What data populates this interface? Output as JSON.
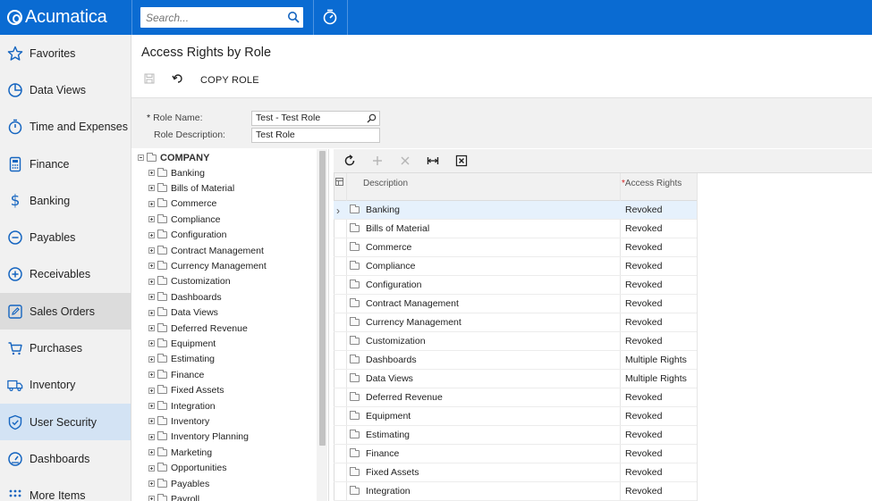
{
  "app": {
    "logo_text": "Acumatica"
  },
  "header": {
    "search_placeholder": "Search..."
  },
  "sidebar": {
    "items": [
      {
        "label": "Favorites",
        "icon": "star-icon"
      },
      {
        "label": "Data Views",
        "icon": "pie-chart-icon"
      },
      {
        "label": "Time and Expenses",
        "icon": "stopwatch-icon"
      },
      {
        "label": "Finance",
        "icon": "calculator-icon"
      },
      {
        "label": "Banking",
        "icon": "dollar-icon"
      },
      {
        "label": "Payables",
        "icon": "minus-circle-icon"
      },
      {
        "label": "Receivables",
        "icon": "plus-circle-icon"
      },
      {
        "label": "Sales Orders",
        "icon": "edit-icon"
      },
      {
        "label": "Purchases",
        "icon": "cart-icon"
      },
      {
        "label": "Inventory",
        "icon": "truck-icon"
      },
      {
        "label": "User Security",
        "icon": "shield-icon"
      },
      {
        "label": "Dashboards",
        "icon": "gauge-icon"
      },
      {
        "label": "More Items",
        "icon": "grid-dots-icon"
      }
    ]
  },
  "page": {
    "title": "Access Rights by Role",
    "toolbar": {
      "copy_role_label": "COPY ROLE"
    },
    "form": {
      "role_name_label": "Role Name:",
      "role_name_value": "Test - Test Role",
      "role_description_label": "Role Description:",
      "role_description_value": "Test Role"
    }
  },
  "tree": {
    "root": "COMPANY",
    "nodes": [
      "Banking",
      "Bills of Material",
      "Commerce",
      "Compliance",
      "Configuration",
      "Contract Management",
      "Currency Management",
      "Customization",
      "Dashboards",
      "Data Views",
      "Deferred Revenue",
      "Equipment",
      "Estimating",
      "Finance",
      "Fixed Assets",
      "Integration",
      "Inventory",
      "Inventory Planning",
      "Marketing",
      "Opportunities",
      "Payables",
      "Payroll"
    ]
  },
  "grid": {
    "columns": {
      "description": "Description",
      "access_rights": "Access Rights"
    },
    "rows": [
      {
        "description": "Banking",
        "access": "Revoked"
      },
      {
        "description": "Bills of Material",
        "access": "Revoked"
      },
      {
        "description": "Commerce",
        "access": "Revoked"
      },
      {
        "description": "Compliance",
        "access": "Revoked"
      },
      {
        "description": "Configuration",
        "access": "Revoked"
      },
      {
        "description": "Contract Management",
        "access": "Revoked"
      },
      {
        "description": "Currency Management",
        "access": "Revoked"
      },
      {
        "description": "Customization",
        "access": "Revoked"
      },
      {
        "description": "Dashboards",
        "access": "Multiple Rights"
      },
      {
        "description": "Data Views",
        "access": "Multiple Rights"
      },
      {
        "description": "Deferred Revenue",
        "access": "Revoked"
      },
      {
        "description": "Equipment",
        "access": "Revoked"
      },
      {
        "description": "Estimating",
        "access": "Revoked"
      },
      {
        "description": "Finance",
        "access": "Revoked"
      },
      {
        "description": "Fixed Assets",
        "access": "Revoked"
      },
      {
        "description": "Integration",
        "access": "Revoked"
      }
    ]
  }
}
